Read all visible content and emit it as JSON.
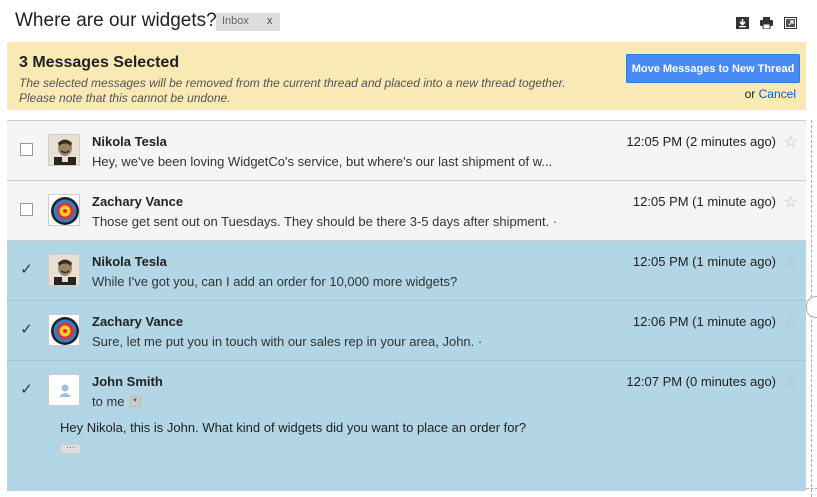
{
  "header": {
    "subject": "Where are our widgets?",
    "label": "Inbox",
    "label_remove": "x",
    "icons": [
      "download-icon",
      "print-icon",
      "new-window-icon"
    ]
  },
  "banner": {
    "title": "3 Messages Selected",
    "description_line1": "The selected messages will be removed from the current thread and placed into a new thread together.",
    "description_line2": "Please note that this cannot be undone.",
    "move_button": "Move Messages to New Thread",
    "or_text": "or",
    "cancel": "Cancel"
  },
  "messages": [
    {
      "selected": false,
      "sender": "Nikola Tesla",
      "avatar": "tesla-portrait",
      "snippet": "Hey, we've been loving WidgetCo's service, but where's our last shipment of w...",
      "time": "12:05 PM (2 minutes ago)"
    },
    {
      "selected": false,
      "sender": "Zachary Vance",
      "avatar": "archery-target",
      "snippet": "Those get sent out on Tuesdays. They should be there 3-5 days after shipment. ·",
      "time": "12:05 PM (1 minute ago)"
    },
    {
      "selected": true,
      "sender": "Nikola Tesla",
      "avatar": "tesla-portrait",
      "snippet": "While I've got you, can I add an order for 10,000 more widgets?",
      "time": "12:05 PM (1 minute ago)"
    },
    {
      "selected": true,
      "sender": "Zachary Vance",
      "avatar": "archery-target",
      "snippet": "Sure, let me put you in touch with our sales rep in your area, John. ·",
      "time": "12:06 PM (1 minute ago)"
    },
    {
      "selected": true,
      "sender": "John Smith",
      "avatar": "default-person",
      "to": "to me",
      "body": "Hey Nikola, this is John. What kind of widgets did you want to place an order for?",
      "time": "12:07 PM (0 minutes ago)"
    }
  ],
  "colors": {
    "banner_bg": "#f9e9b4",
    "selected_bg": "#b2d6e5",
    "button_blue": "#4a8af4",
    "link_blue": "#1155cc"
  }
}
